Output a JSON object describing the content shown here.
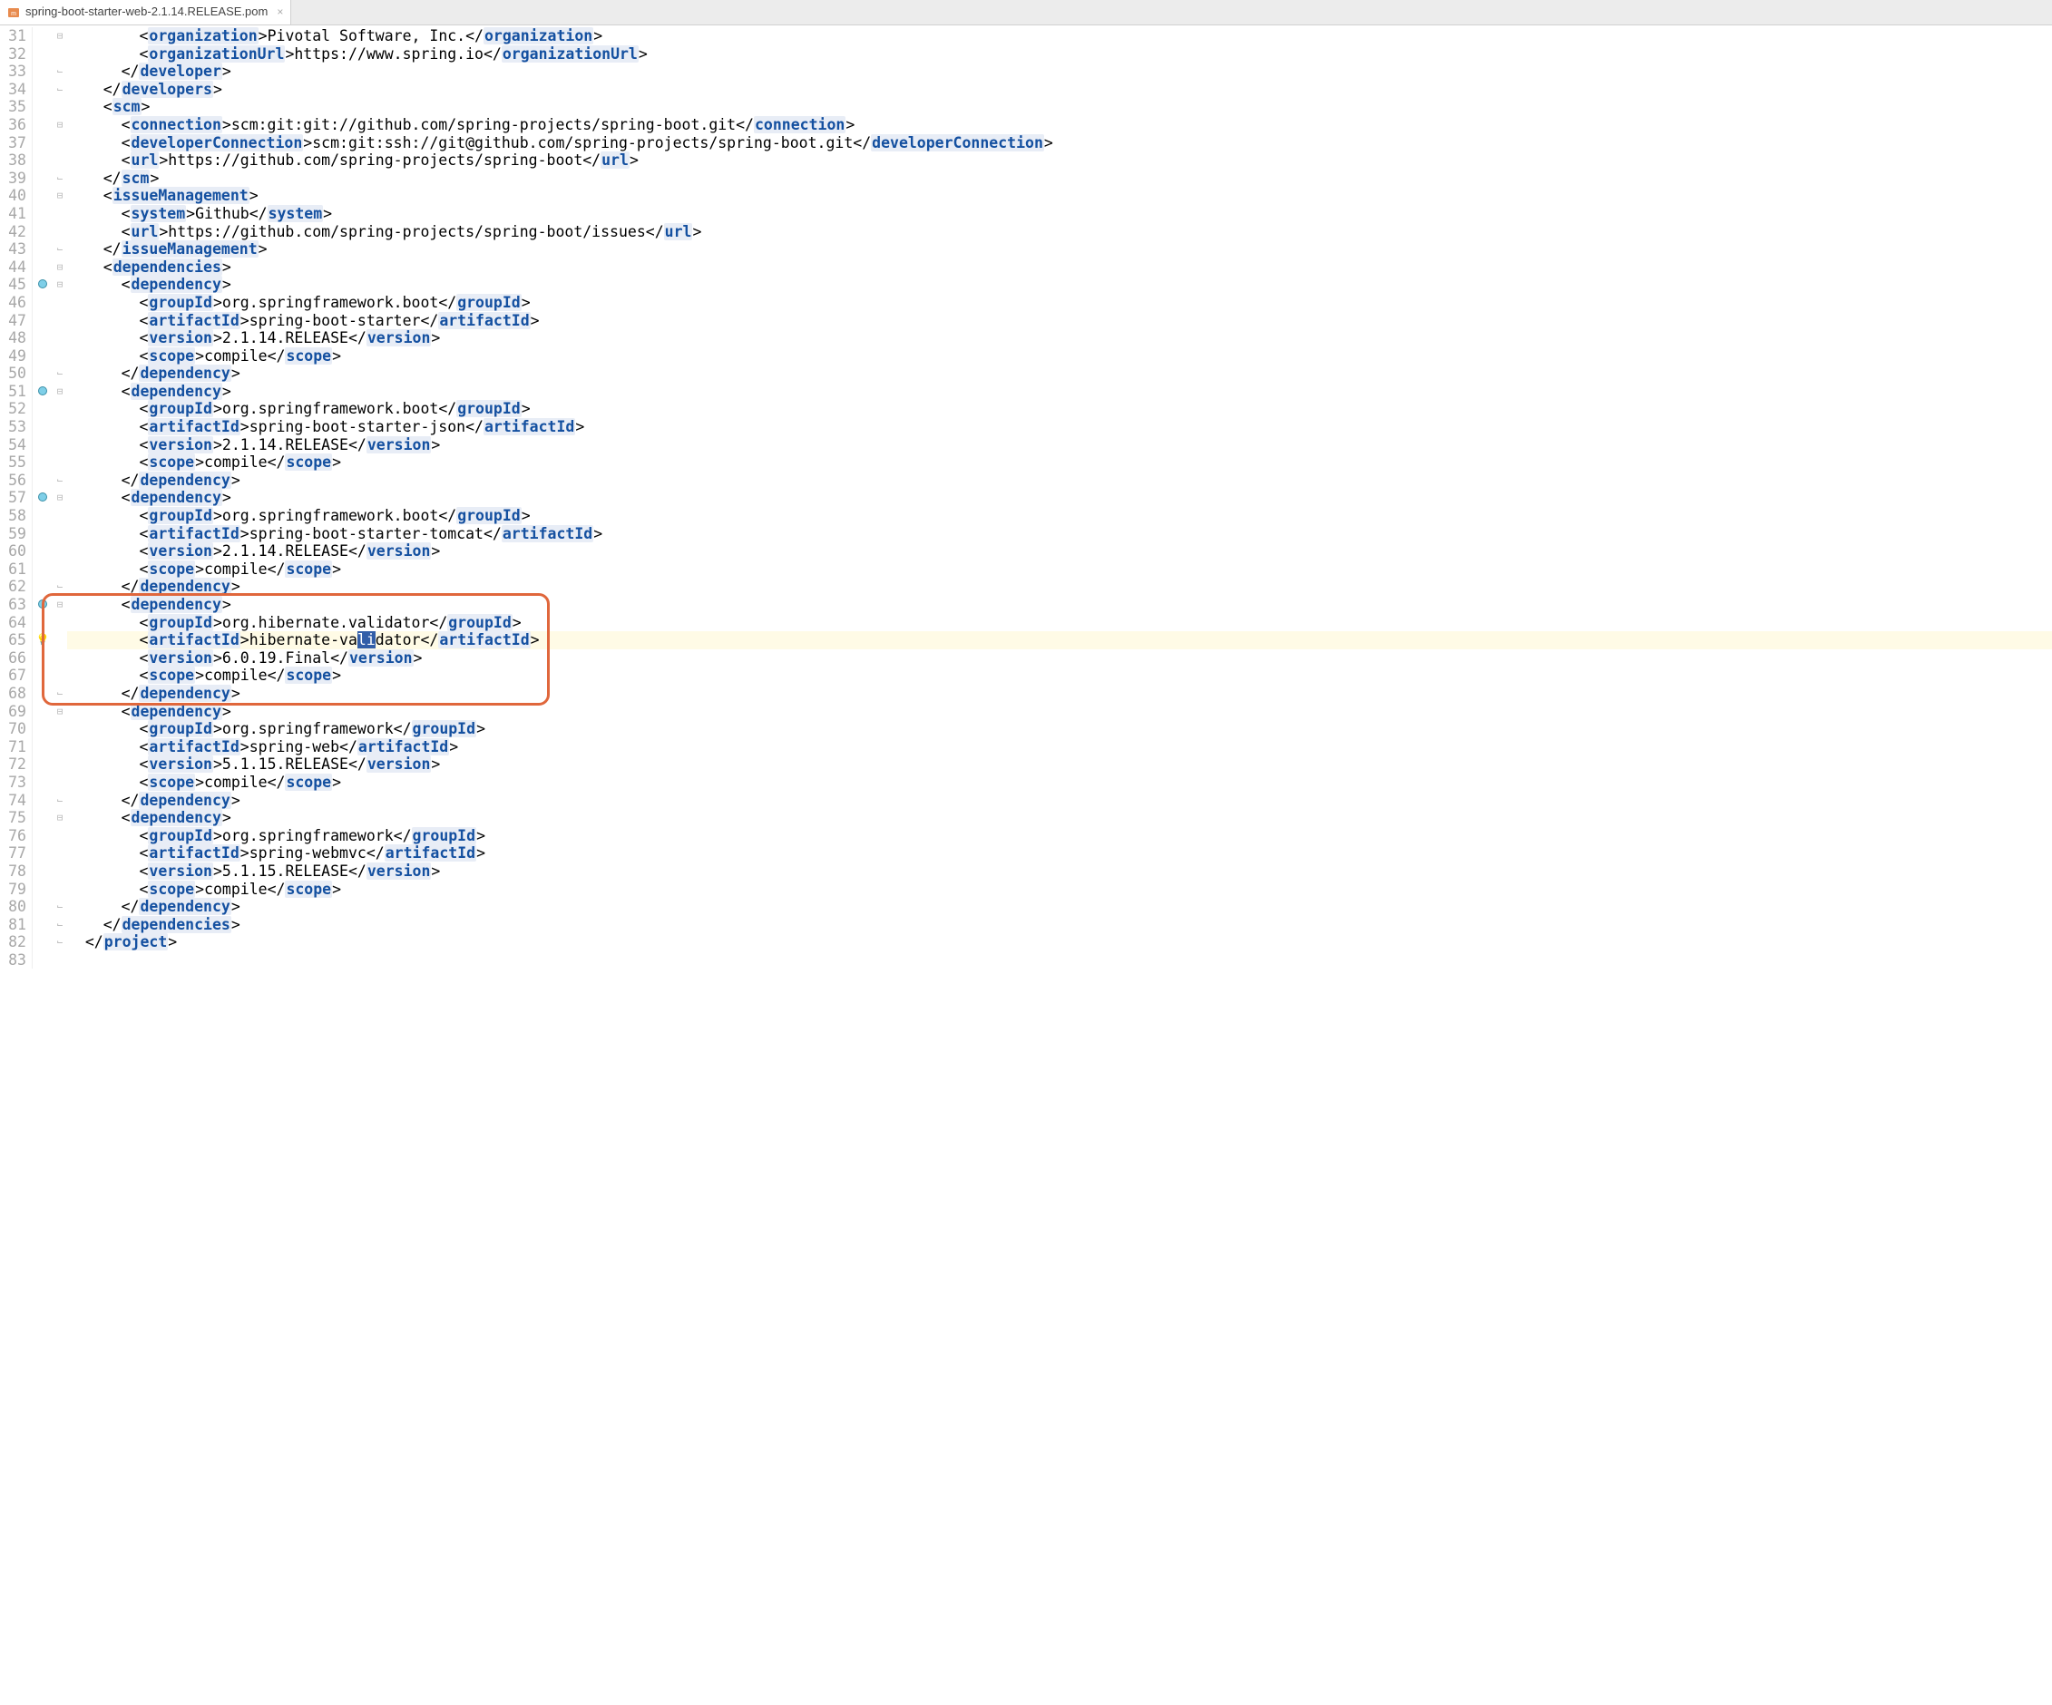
{
  "tab": {
    "filename": "spring-boot-starter-web-2.1.14.RELEASE.pom"
  },
  "editor": {
    "first_line": 31,
    "current_line": 65,
    "highlight_box": {
      "start": 63,
      "end": 68
    },
    "dep_markers": [
      45,
      51,
      57,
      63
    ],
    "bulb_line": 65,
    "fold_open": [
      31,
      36,
      40,
      44,
      45,
      51,
      57,
      63,
      69,
      75
    ],
    "fold_close": [
      33,
      34,
      39,
      43,
      50,
      56,
      62,
      68,
      74,
      80,
      81,
      82
    ]
  },
  "lines": {
    "31": {
      "i": 3,
      "pre": "<",
      "tag": "organization",
      "mid": ">Pivotal Software, Inc.</",
      "tag2": "organization",
      "post": ">",
      "truncated_top": true
    },
    "32": {
      "i": 3,
      "pre": "<",
      "tag": "organizationUrl",
      "mid": ">https://www.spring.io</",
      "tag2": "organizationUrl",
      "post": ">"
    },
    "33": {
      "i": 2,
      "pre": "</",
      "tag": "developer",
      "post": ">"
    },
    "34": {
      "i": 1,
      "pre": "</",
      "tag": "developers",
      "post": ">"
    },
    "35": {
      "i": 1,
      "pre": "<",
      "tag": "scm",
      "post": ">"
    },
    "36": {
      "i": 2,
      "pre": "<",
      "tag": "connection",
      "mid": ">scm:git:git://github.com/spring-projects/spring-boot.git</",
      "tag2": "connection",
      "post": ">"
    },
    "37": {
      "i": 2,
      "pre": "<",
      "tag": "developerConnection",
      "mid": ">scm:git:ssh://git@github.com/spring-projects/spring-boot.git</",
      "tag2": "developerConnection",
      "post": ">"
    },
    "38": {
      "i": 2,
      "pre": "<",
      "tag": "url",
      "mid": ">https://github.com/spring-projects/spring-boot</",
      "tag2": "url",
      "post": ">"
    },
    "39": {
      "i": 1,
      "pre": "</",
      "tag": "scm",
      "post": ">"
    },
    "40": {
      "i": 1,
      "pre": "<",
      "tag": "issueManagement",
      "post": ">"
    },
    "41": {
      "i": 2,
      "pre": "<",
      "tag": "system",
      "mid": ">Github</",
      "tag2": "system",
      "post": ">"
    },
    "42": {
      "i": 2,
      "pre": "<",
      "tag": "url",
      "mid": ">https://github.com/spring-projects/spring-boot/issues</",
      "tag2": "url",
      "post": ">"
    },
    "43": {
      "i": 1,
      "pre": "</",
      "tag": "issueManagement",
      "post": ">"
    },
    "44": {
      "i": 1,
      "pre": "<",
      "tag": "dependencies",
      "post": ">"
    },
    "45": {
      "i": 2,
      "pre": "<",
      "tag": "dependency",
      "post": ">"
    },
    "46": {
      "i": 3,
      "pre": "<",
      "tag": "groupId",
      "mid": ">org.springframework.boot</",
      "tag2": "groupId",
      "post": ">"
    },
    "47": {
      "i": 3,
      "pre": "<",
      "tag": "artifactId",
      "mid": ">spring-boot-starter</",
      "tag2": "artifactId",
      "post": ">"
    },
    "48": {
      "i": 3,
      "pre": "<",
      "tag": "version",
      "mid": ">2.1.14.RELEASE</",
      "tag2": "version",
      "post": ">"
    },
    "49": {
      "i": 3,
      "pre": "<",
      "tag": "scope",
      "mid": ">compile</",
      "tag2": "scope",
      "post": ">"
    },
    "50": {
      "i": 2,
      "pre": "</",
      "tag": "dependency",
      "post": ">"
    },
    "51": {
      "i": 2,
      "pre": "<",
      "tag": "dependency",
      "post": ">"
    },
    "52": {
      "i": 3,
      "pre": "<",
      "tag": "groupId",
      "mid": ">org.springframework.boot</",
      "tag2": "groupId",
      "post": ">"
    },
    "53": {
      "i": 3,
      "pre": "<",
      "tag": "artifactId",
      "mid": ">spring-boot-starter-json</",
      "tag2": "artifactId",
      "post": ">"
    },
    "54": {
      "i": 3,
      "pre": "<",
      "tag": "version",
      "mid": ">2.1.14.RELEASE</",
      "tag2": "version",
      "post": ">"
    },
    "55": {
      "i": 3,
      "pre": "<",
      "tag": "scope",
      "mid": ">compile</",
      "tag2": "scope",
      "post": ">"
    },
    "56": {
      "i": 2,
      "pre": "</",
      "tag": "dependency",
      "post": ">"
    },
    "57": {
      "i": 2,
      "pre": "<",
      "tag": "dependency",
      "post": ">"
    },
    "58": {
      "i": 3,
      "pre": "<",
      "tag": "groupId",
      "mid": ">org.springframework.boot</",
      "tag2": "groupId",
      "post": ">"
    },
    "59": {
      "i": 3,
      "pre": "<",
      "tag": "artifactId",
      "mid": ">spring-boot-starter-tomcat</",
      "tag2": "artifactId",
      "post": ">"
    },
    "60": {
      "i": 3,
      "pre": "<",
      "tag": "version",
      "mid": ">2.1.14.RELEASE</",
      "tag2": "version",
      "post": ">"
    },
    "61": {
      "i": 3,
      "pre": "<",
      "tag": "scope",
      "mid": ">compile</",
      "tag2": "scope",
      "post": ">"
    },
    "62": {
      "i": 2,
      "pre": "</",
      "tag": "dependency",
      "post": ">"
    },
    "63": {
      "i": 2,
      "pre": "<",
      "tag": "dependency",
      "post": ">"
    },
    "64": {
      "i": 3,
      "pre": "<",
      "tag": "groupId",
      "mid": ">org.hibernate.validator</",
      "tag2": "groupId",
      "post": ">"
    },
    "65": {
      "i": 3,
      "pre": "<",
      "tag": "artifactId",
      "mid_parts": [
        ">hibernate-va",
        "li",
        "dator</"
      ],
      "tag2": "artifactId",
      "post": ">"
    },
    "66": {
      "i": 3,
      "pre": "<",
      "tag": "version",
      "mid": ">6.0.19.Final</",
      "tag2": "version",
      "post": ">"
    },
    "67": {
      "i": 3,
      "pre": "<",
      "tag": "scope",
      "mid": ">compile</",
      "tag2": "scope",
      "post": ">"
    },
    "68": {
      "i": 2,
      "pre": "</",
      "tag": "dependency",
      "post": ">"
    },
    "69": {
      "i": 2,
      "pre": "<",
      "tag": "dependency",
      "post": ">"
    },
    "70": {
      "i": 3,
      "pre": "<",
      "tag": "groupId",
      "mid": ">org.springframework</",
      "tag2": "groupId",
      "post": ">"
    },
    "71": {
      "i": 3,
      "pre": "<",
      "tag": "artifactId",
      "mid": ">spring-web</",
      "tag2": "artifactId",
      "post": ">"
    },
    "72": {
      "i": 3,
      "pre": "<",
      "tag": "version",
      "mid": ">5.1.15.RELEASE</",
      "tag2": "version",
      "post": ">"
    },
    "73": {
      "i": 3,
      "pre": "<",
      "tag": "scope",
      "mid": ">compile</",
      "tag2": "scope",
      "post": ">"
    },
    "74": {
      "i": 2,
      "pre": "</",
      "tag": "dependency",
      "post": ">"
    },
    "75": {
      "i": 2,
      "pre": "<",
      "tag": "dependency",
      "post": ">"
    },
    "76": {
      "i": 3,
      "pre": "<",
      "tag": "groupId",
      "mid": ">org.springframework</",
      "tag2": "groupId",
      "post": ">"
    },
    "77": {
      "i": 3,
      "pre": "<",
      "tag": "artifactId",
      "mid": ">spring-webmvc</",
      "tag2": "artifactId",
      "post": ">"
    },
    "78": {
      "i": 3,
      "pre": "<",
      "tag": "version",
      "mid": ">5.1.15.RELEASE</",
      "tag2": "version",
      "post": ">"
    },
    "79": {
      "i": 3,
      "pre": "<",
      "tag": "scope",
      "mid": ">compile</",
      "tag2": "scope",
      "post": ">"
    },
    "80": {
      "i": 2,
      "pre": "</",
      "tag": "dependency",
      "post": ">"
    },
    "81": {
      "i": 1,
      "pre": "</",
      "tag": "dependencies",
      "post": ">"
    },
    "82": {
      "i": 0,
      "pre": "</",
      "tag": "project",
      "post": ">"
    },
    "83": {
      "empty": true
    }
  }
}
